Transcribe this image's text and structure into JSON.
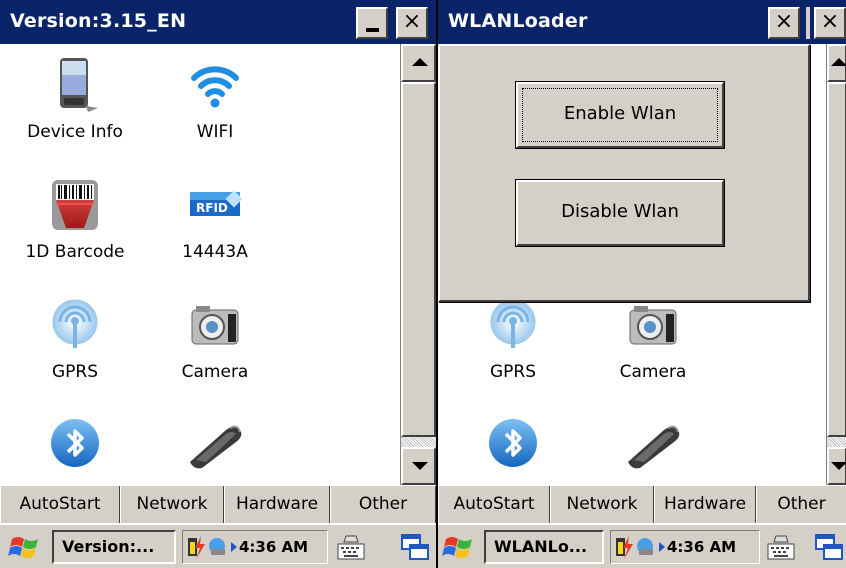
{
  "left_window": {
    "title": "Version:3.15_EN",
    "buttons": {
      "minimize": "_",
      "close": "×"
    },
    "icons": [
      {
        "label": "Device Info",
        "icon": "device-info-icon"
      },
      {
        "label": "WIFI",
        "icon": "wifi-icon"
      },
      {
        "label": "1D Barcode",
        "icon": "barcode-icon"
      },
      {
        "label": "14443A",
        "icon": "rfid-icon"
      },
      {
        "label": "GPRS",
        "icon": "gprs-icon"
      },
      {
        "label": "Camera",
        "icon": "camera-icon"
      },
      {
        "label": "",
        "icon": "bluetooth-icon"
      },
      {
        "label": "",
        "icon": "scanner-icon"
      }
    ],
    "tabs": [
      "AutoStart",
      "Network",
      "Hardware",
      "Other"
    ],
    "taskbar": {
      "task_label": "Version:...",
      "time": "4:36 AM"
    }
  },
  "right_window": {
    "title": "WLANLoader",
    "buttons": {
      "close": "×"
    },
    "dialog": {
      "enable_label": "Enable Wlan",
      "disable_label": "Disable Wlan"
    },
    "icons": [
      {
        "label": "GPRS",
        "icon": "gprs-icon"
      },
      {
        "label": "Camera",
        "icon": "camera-icon"
      },
      {
        "label": "",
        "icon": "bluetooth-icon"
      },
      {
        "label": "",
        "icon": "scanner-icon"
      }
    ],
    "tabs": [
      "AutoStart",
      "Network",
      "Hardware",
      "Other"
    ],
    "taskbar": {
      "task_label": "WLANLo...",
      "time": "4:36 AM"
    }
  },
  "colors": {
    "titlebar": "#0a246a",
    "chrome": "#d4d0c8",
    "bluetooth": "#2a8ad8",
    "wifi": "#1e8ee0"
  }
}
